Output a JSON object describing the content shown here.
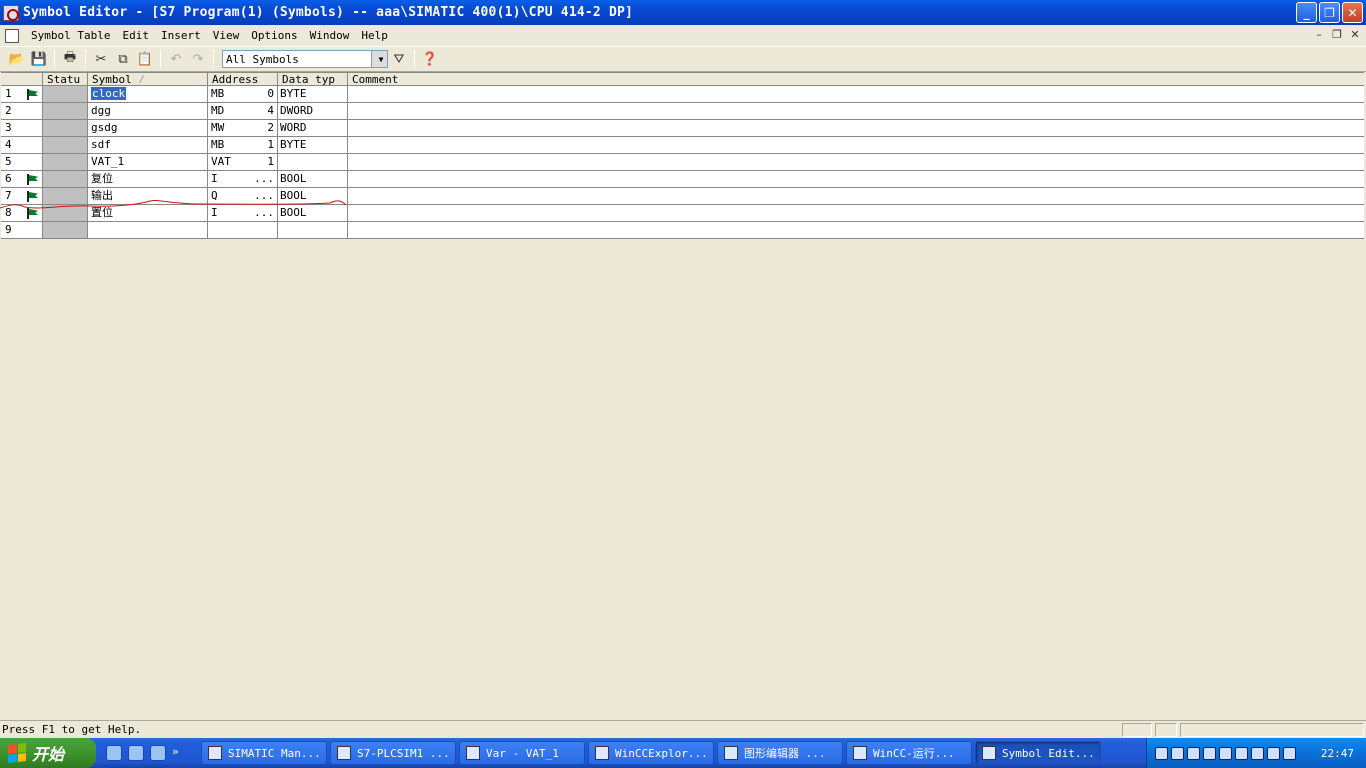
{
  "window": {
    "title": "Symbol Editor - [S7 Program(1) (Symbols) -- aaa\\SIMATIC 400(1)\\CPU 414-2 DP]",
    "minimize": "_",
    "restore": "❐",
    "close": "✕"
  },
  "menu": {
    "items": [
      "Symbol Table",
      "Edit",
      "Insert",
      "View",
      "Options",
      "Window",
      "Help"
    ],
    "mdi_min": "–",
    "mdi_restore": "❐",
    "mdi_close": "✕"
  },
  "toolbar": {
    "filter_value": "All Symbols"
  },
  "table": {
    "headers": {
      "status": "Statu",
      "symbol": "Symbol",
      "address": "Address",
      "data_type": "Data typ",
      "comment": "Comment"
    },
    "sort_indicator": "⁄",
    "rows": [
      {
        "num": "1",
        "flag": true,
        "symbol": "clock",
        "addr_type": "MB",
        "addr_num": "0",
        "data_type": "BYTE",
        "comment": ""
      },
      {
        "num": "2",
        "flag": false,
        "symbol": "dgg",
        "addr_type": "MD",
        "addr_num": "4",
        "data_type": "DWORD",
        "comment": ""
      },
      {
        "num": "3",
        "flag": false,
        "symbol": "gsdg",
        "addr_type": "MW",
        "addr_num": "2",
        "data_type": "WORD",
        "comment": ""
      },
      {
        "num": "4",
        "flag": false,
        "symbol": "sdf",
        "addr_type": "MB",
        "addr_num": "1",
        "data_type": "BYTE",
        "comment": ""
      },
      {
        "num": "5",
        "flag": false,
        "symbol": "VAT_1",
        "addr_type": "VAT",
        "addr_num": "1",
        "data_type": "",
        "comment": ""
      },
      {
        "num": "6",
        "flag": true,
        "symbol": "复位",
        "addr_type": "I",
        "addr_num": "...",
        "data_type": "BOOL",
        "comment": ""
      },
      {
        "num": "7",
        "flag": true,
        "symbol": "输出",
        "addr_type": "Q",
        "addr_num": "...",
        "data_type": "BOOL",
        "comment": ""
      },
      {
        "num": "8",
        "flag": true,
        "symbol": "置位",
        "addr_type": "I",
        "addr_num": "...",
        "data_type": "BOOL",
        "comment": ""
      },
      {
        "num": "9",
        "flag": false,
        "symbol": "",
        "addr_type": "",
        "addr_num": "",
        "data_type": "",
        "comment": ""
      }
    ]
  },
  "statusbar": {
    "message": "Press F1 to get Help."
  },
  "taskbar": {
    "start_label": "开始",
    "tasks": [
      {
        "label": "SIMATIC Man..."
      },
      {
        "label": "S7-PLCSIM1 ..."
      },
      {
        "label": "Var - VAT_1"
      },
      {
        "label": "WinCCExplor..."
      },
      {
        "label": "图形编辑器 ..."
      },
      {
        "label": "WinCC-运行..."
      },
      {
        "label": "Symbol Edit..."
      }
    ],
    "clock": "22:47"
  }
}
